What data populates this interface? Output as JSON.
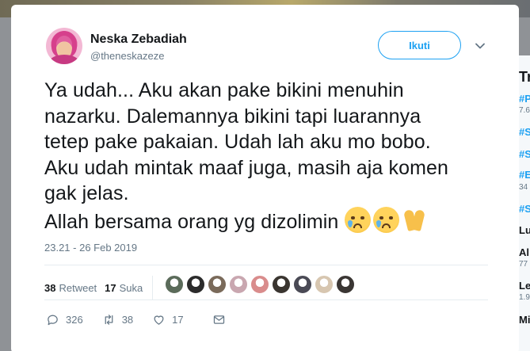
{
  "trends": {
    "title": "Tr",
    "items": [
      {
        "label": "#P",
        "sub": "7.6"
      },
      {
        "label": "#S",
        "sub": ""
      },
      {
        "label": "#S",
        "sub": ""
      },
      {
        "label": "#E",
        "sub": "34"
      },
      {
        "label": "#S",
        "sub": ""
      },
      {
        "label": "Lu",
        "sub": ""
      },
      {
        "label": "Al",
        "sub": "77"
      },
      {
        "label": "Le",
        "sub": "1.9"
      },
      {
        "label": "Mi",
        "sub": ""
      }
    ]
  },
  "tweet": {
    "author_name": "Neska Zebadiah",
    "author_handle": "@theneskazeze",
    "follow_label": "Ikuti",
    "text_lines": [
      "Ya udah... Aku akan pake bikini menuhin",
      "nazarku. Dalemannya bikini tapi luarannya",
      "tetep pake pakaian. Udah lah aku mo bobo.",
      "Aku udah mintak maaf juga, masih aja komen",
      "gak jelas.",
      "Allah bersama orang yg dizolimin"
    ],
    "emojis": [
      "crying-face-icon",
      "crying-face-icon",
      "folded-hands-icon"
    ],
    "timestamp": "23.21 - 26 Feb 2019",
    "retweet_count": "38",
    "retweet_label": "Retweet",
    "like_count": "17",
    "like_label": "Suka",
    "reply_action_count": "326",
    "retweet_action_count": "38",
    "like_action_count": "17"
  },
  "likers": [
    "#5b6b5a",
    "#2b2b2b",
    "#7a6a5a",
    "#c9a7b0",
    "#d98c8c",
    "#3a3530",
    "#4a4a55",
    "#d7c6b0",
    "#3a3633"
  ],
  "colors": {
    "accent": "#1da1f2",
    "text": "#14171a",
    "muted": "#657786"
  }
}
